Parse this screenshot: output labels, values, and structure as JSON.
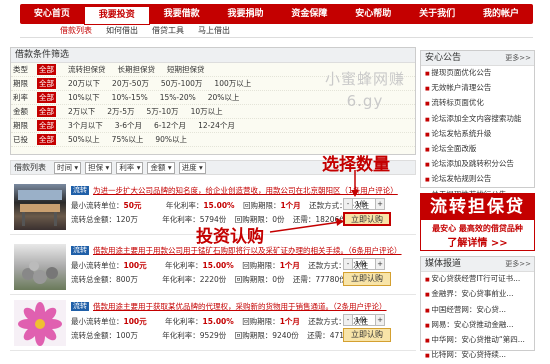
{
  "nav": {
    "items": [
      "安心首页",
      "我要投资",
      "我要借款",
      "我要捐助",
      "资金保障",
      "安心帮助",
      "关于我们",
      "我的帐户"
    ]
  },
  "subnav": {
    "items": [
      "借款列表",
      "如何借出",
      "借贷工具",
      "马上借出"
    ]
  },
  "filter": {
    "title": "借款条件筛选",
    "rows": [
      {
        "label": "类型",
        "options": [
          "全部",
          "流转担保贷",
          "长期担保贷",
          "短期担保贷"
        ]
      },
      {
        "label": "期限",
        "options": [
          "全部",
          "20万以下",
          "20万-50万",
          "50万-100万",
          "100万以上"
        ]
      },
      {
        "label": "利率",
        "options": [
          "全部",
          "10%以下",
          "10%-15%",
          "15%-20%",
          "20%以上"
        ]
      },
      {
        "label": "金额",
        "options": [
          "全部",
          "2万以下",
          "2万-5万",
          "5万-10万",
          "10万以上"
        ]
      },
      {
        "label": "期限",
        "options": [
          "全部",
          "3个月以下",
          "3-6个月",
          "6-12个月",
          "12-24个月"
        ]
      },
      {
        "label": "已投",
        "options": [
          "全部",
          "50%以上",
          "75%以上",
          "90%以上"
        ]
      }
    ]
  },
  "watermark": {
    "line1": "小蜜蜂网赚",
    "line2": "6.gy"
  },
  "sortbar": {
    "title": "借款列表",
    "buttons": [
      "时间",
      "担保",
      "利率",
      "金额",
      "进度"
    ]
  },
  "items": [
    {
      "tag": "流转",
      "title": "为进一步扩大公司品牌的知名度，给企业创造营收，用款公司在北京朝阳区（1条用户评论）",
      "min_label": "最小流转单位：",
      "min_value": "50元",
      "rate_label": "年化利率：",
      "rate_value": "15.00%",
      "term_label": "回购期限：",
      "term_value": "1个月",
      "repay_label": "还款方式：",
      "repay_value": "一次性",
      "total_label": "流转总金额：",
      "total_value": "120万",
      "profit_label": "年化利率：",
      "profit_value": "5794份",
      "recall_label": "回购期限：",
      "recall_value": "0份",
      "remain_label": "还需：",
      "remain_value": "18206份",
      "qty": "1份",
      "buy": "立即认购"
    },
    {
      "tag": "流转",
      "title": "借款用途主要用于用款公司用于锰矿石购即将行以及采矿证办理的相关手续。（6条用户评论）",
      "min_label": "最小流转单位：",
      "min_value": "100元",
      "rate_label": "年化利率：",
      "rate_value": "15.00%",
      "term_label": "回购期限：",
      "term_value": "1个月",
      "repay_label": "还款方式：",
      "repay_value": "一次性",
      "total_label": "流转总金额：",
      "total_value": "800万",
      "profit_label": "年化利率：",
      "profit_value": "2220份",
      "recall_label": "回购期限：",
      "recall_value": "0份",
      "remain_label": "还需：",
      "remain_value": "77780份",
      "qty": "1份",
      "buy": "立即认购"
    },
    {
      "tag": "流转",
      "title": "借款用途主要用于获取某优品牌的代理权，采购新的货物用于销售通道。（2条用户评论）",
      "min_label": "最小流转单位：",
      "min_value": "100元",
      "rate_label": "年化利率：",
      "rate_value": "15.00%",
      "term_label": "回购期限：",
      "term_value": "1个月",
      "repay_label": "还款方式：",
      "repay_value": "一次性",
      "total_label": "流转总金额：",
      "total_value": "100万",
      "profit_label": "年化利率：",
      "profit_value": "9529份",
      "recall_label": "回购期限：",
      "recall_value": "9240份",
      "remain_label": "还需：",
      "remain_value": "471份",
      "qty": "1份",
      "buy": "立即认购"
    }
  ],
  "annotations": {
    "qty": "选择数量",
    "buy": "投资认购"
  },
  "notice": {
    "title": "安心公告",
    "more": "更多>>",
    "items": [
      "提现页面优化公告",
      "无效帐户清理公告",
      "流转标页面优化",
      "论坛添加全文内容搜索功能",
      "论坛发帖系统升级",
      "论坛全面改版",
      "论坛添加及跳转积分公告",
      "论坛发帖规则公告",
      "关于提现推荐排行公告"
    ]
  },
  "banner": {
    "line1": "流转担保贷",
    "line2": "最安心 最高效的借贷品种",
    "line3": "了解详情 >>"
  },
  "media": {
    "title": "媒体报道",
    "more": "更多>>",
    "items": [
      "安心贷获经营IT行可证书...",
      "金融界：安心贷事前业...",
      "中国经营网：安心贷...",
      "网易：安心贷推动金融...",
      "中华网：安心贷推动“第四...",
      "比特网：安心贷持续..."
    ]
  }
}
